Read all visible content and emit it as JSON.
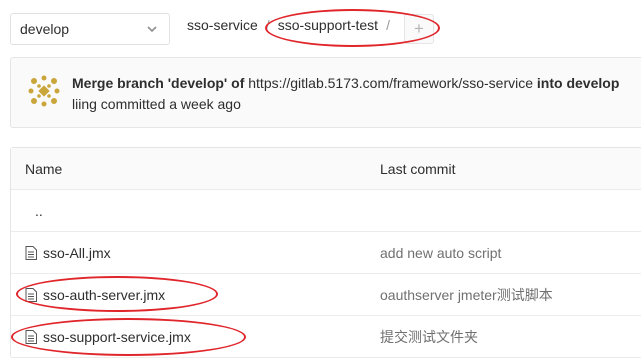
{
  "branch": {
    "selected": "develop"
  },
  "breadcrumb": {
    "project": "sso-service",
    "separator1": "/",
    "folder": "sso-support-test",
    "separator2": "/",
    "add_symbol": "+"
  },
  "commit": {
    "message_start": "Merge branch 'develop' of",
    "message_link": "https://gitlab.5173.com/framework/sso-service",
    "message_end": "into develop",
    "meta": "liing committed a week ago"
  },
  "table": {
    "headers": {
      "name": "Name",
      "last_commit": "Last commit"
    },
    "parent": "..",
    "rows": [
      {
        "name": "sso-All.jmx",
        "last_commit": "add new auto script"
      },
      {
        "name": "sso-auth-server.jmx",
        "last_commit": "oauthserver jmeter测试脚本"
      },
      {
        "name": "sso-support-service.jmx",
        "last_commit": "提交测试文件夹"
      }
    ]
  },
  "icons": {
    "chevron": "chevron-down-icon",
    "file": "file-icon",
    "avatar": "identicon-avatar",
    "add": "plus-icon"
  },
  "colors": {
    "annotation": "#e0262b",
    "panel_bg": "#fafafa",
    "border": "#e5e5e5"
  }
}
